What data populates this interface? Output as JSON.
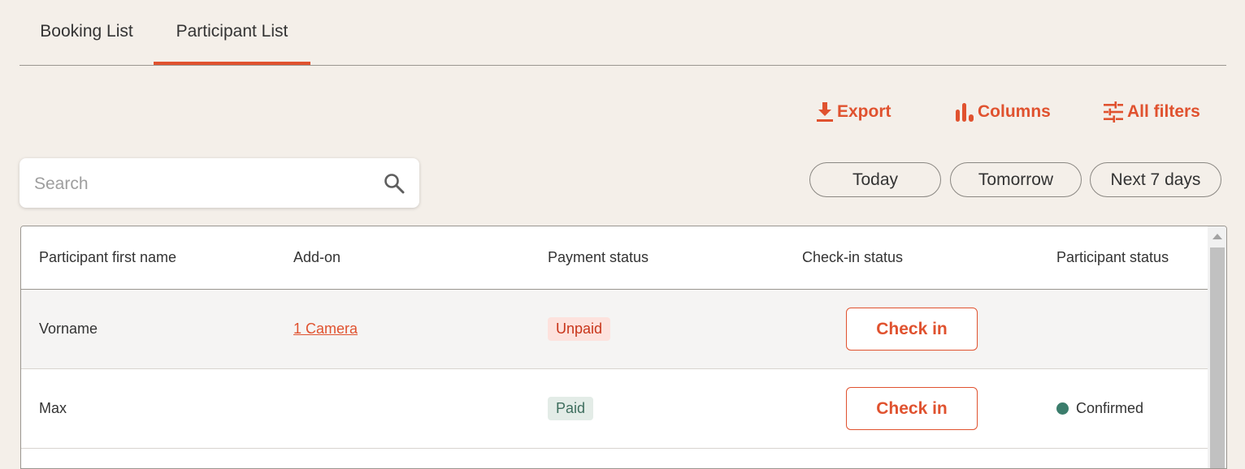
{
  "tabs": [
    {
      "label": "Booking List",
      "active": false
    },
    {
      "label": "Participant List",
      "active": true
    }
  ],
  "toolbar": {
    "export_label": "Export",
    "columns_label": "Columns",
    "filters_label": "All filters"
  },
  "search": {
    "placeholder": "Search",
    "value": ""
  },
  "date_filters": [
    "Today",
    "Tomorrow",
    "Next 7 days"
  ],
  "table": {
    "columns": [
      "Participant first name",
      "Add-on",
      "Payment status",
      "Check-in status",
      "Participant status"
    ],
    "rows": [
      {
        "first_name": "Vorname",
        "addon": "1 Camera",
        "payment": "Unpaid",
        "checkin": "Check in",
        "status": ""
      },
      {
        "first_name": "Max",
        "addon": "",
        "payment": "Paid",
        "checkin": "Check in",
        "status": "Confirmed"
      }
    ]
  },
  "colors": {
    "accent": "#e0522f",
    "background": "#f4efe9",
    "unpaid_bg": "#fde2dd",
    "paid_bg": "#e3ece7",
    "confirmed_dot": "#3b7d6c"
  },
  "icons": {
    "export": "download-icon",
    "columns": "bar-chart-icon",
    "filters": "sliders-icon",
    "search": "search-icon"
  }
}
